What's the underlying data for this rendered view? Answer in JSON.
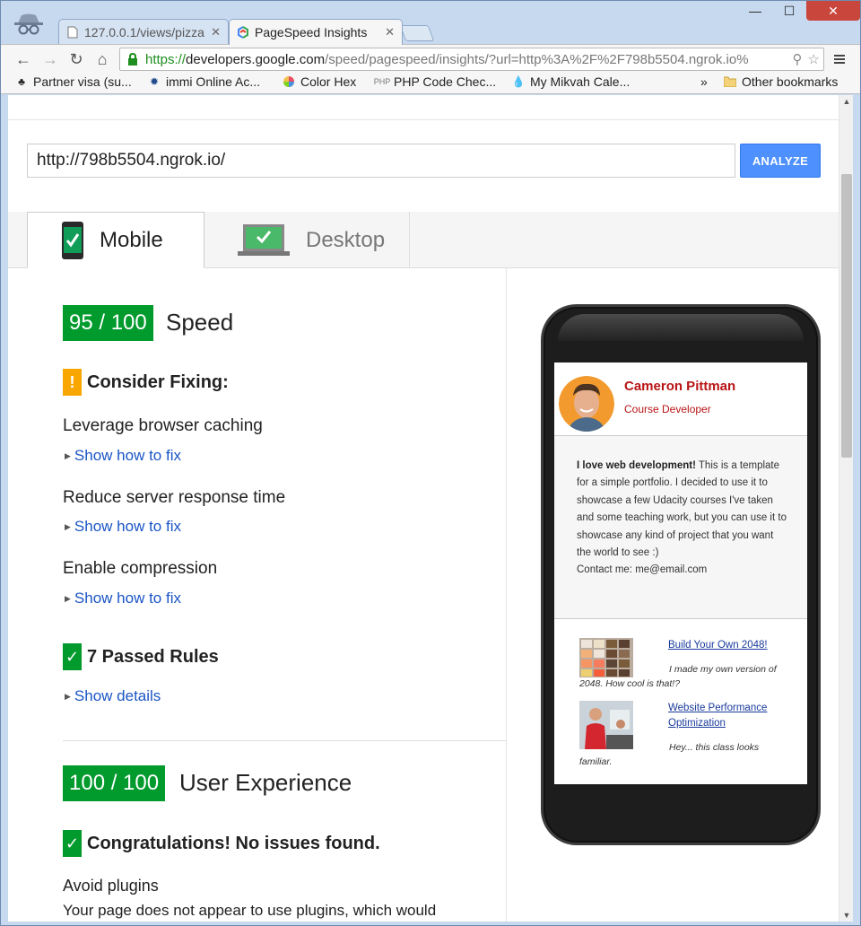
{
  "browser": {
    "tabs": [
      {
        "title": "127.0.0.1/views/pizza"
      },
      {
        "title": "PageSpeed Insights"
      }
    ],
    "window_controls": {
      "minimize": "—",
      "maximize": "☐",
      "close": "✕"
    },
    "address": {
      "scheme": "https://",
      "host": "developers.google.com",
      "path": "/speed/pagespeed/insights/?url=http%3A%2F%2F798b5504.ngrok.io%"
    },
    "bookmarks": [
      {
        "label": "Partner visa (su..."
      },
      {
        "label": "immi Online Ac..."
      },
      {
        "label": "Color Hex"
      },
      {
        "label": "PHP Code Chec..."
      },
      {
        "label": "My Mikvah Cale..."
      }
    ],
    "bookmarks_overflow": "»",
    "other_bookmarks": "Other bookmarks"
  },
  "page": {
    "url_input_value": "http://798b5504.ngrok.io/",
    "analyze_label": "ANALYZE",
    "device_tabs": [
      {
        "label": "Mobile",
        "active": true
      },
      {
        "label": "Desktop",
        "active": false
      }
    ],
    "speed": {
      "score": "95 / 100",
      "label": "Speed",
      "consider_fixing": "Consider Fixing:",
      "rules": [
        {
          "title": "Leverage browser caching",
          "link": "Show how to fix"
        },
        {
          "title": "Reduce server response time",
          "link": "Show how to fix"
        },
        {
          "title": "Enable compression",
          "link": "Show how to fix"
        }
      ],
      "passed_rules": "7 Passed Rules",
      "show_details": "Show details"
    },
    "user_experience": {
      "score": "100 / 100",
      "label": "User Experience",
      "congrats": "Congratulations! No issues found.",
      "rule_title": "Avoid plugins",
      "rule_desc": "Your page does not appear to use plugins, which would"
    },
    "preview": {
      "name": "Cameron Pittman",
      "role": "Course Developer",
      "about_bold": "I love web development!",
      "about_text": " This is a template for a simple portfolio. I decided to use it to showcase a few Udacity courses I've taken and some teaching work, but you can use it to showcase any kind of project that you want the world to see :)",
      "contact": "Contact me: me@email.com",
      "projects": [
        {
          "title": "Build Your Own 2048!",
          "desc": "I made my own version of 2048. How cool is that!?"
        },
        {
          "title": "Website Performance Optimization",
          "desc": "Hey... this class looks familiar."
        }
      ]
    }
  },
  "colors": {
    "score_green": "#009a2d",
    "warning_orange": "#f9a600",
    "link_blue": "#1a55c5",
    "analyze_blue": "#4d90fe",
    "portfolio_red": "#b81414"
  },
  "icons": [
    "incognito-icon",
    "page-icon",
    "pagespeed-icon",
    "back-icon",
    "forward-icon",
    "reload-icon",
    "home-icon",
    "lock-icon",
    "zoom-icon",
    "star-icon",
    "menu-icon",
    "folder-icon",
    "phone-check-icon",
    "laptop-check-icon",
    "warning-icon",
    "checkmark-icon"
  ]
}
